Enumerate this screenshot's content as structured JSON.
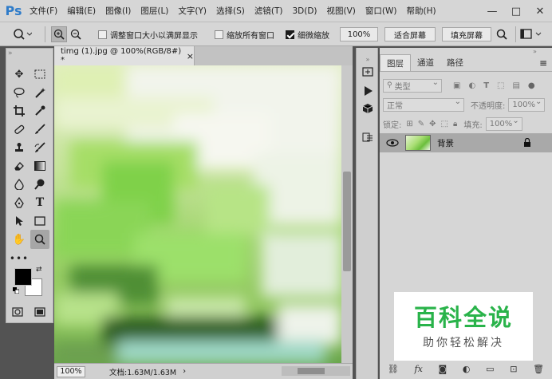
{
  "app": {
    "logo": "Ps",
    "menu": [
      "文件(F)",
      "编辑(E)",
      "图像(I)",
      "图层(L)",
      "文字(Y)",
      "选择(S)",
      "滤镜(T)",
      "3D(D)",
      "视图(V)",
      "窗口(W)",
      "帮助(H)"
    ],
    "window_controls": [
      "—",
      "□",
      "✕"
    ]
  },
  "options": {
    "fit_window": "调整窗口大小以满屏显示",
    "zoom_all": "缩放所有窗口",
    "scrubby_zoom": "细微缩放",
    "zoom_value": "100%",
    "fit_screen": "适合屏幕",
    "fill_screen": "填充屏幕"
  },
  "document": {
    "tab_title": "timg (1).jpg @ 100%(RGB/8#) *",
    "tab_close": "×",
    "status_zoom": "100%",
    "status_doc": "文档:1.63M/1.63M"
  },
  "layers_panel": {
    "tabs": [
      "图层",
      "通道",
      "路径"
    ],
    "filter_type": "类型",
    "blend_mode": "正常",
    "opacity_label": "不透明度:",
    "opacity_value": "100%",
    "lock_label": "锁定:",
    "fill_label": "填充:",
    "fill_value": "100%",
    "layer_name": "背景"
  },
  "watermark": {
    "title": "百科全说",
    "subtitle": "助你轻松解决"
  },
  "colors": {
    "foreground": "#000000",
    "background": "#ffffff",
    "watermark_green": "#29b34a"
  }
}
